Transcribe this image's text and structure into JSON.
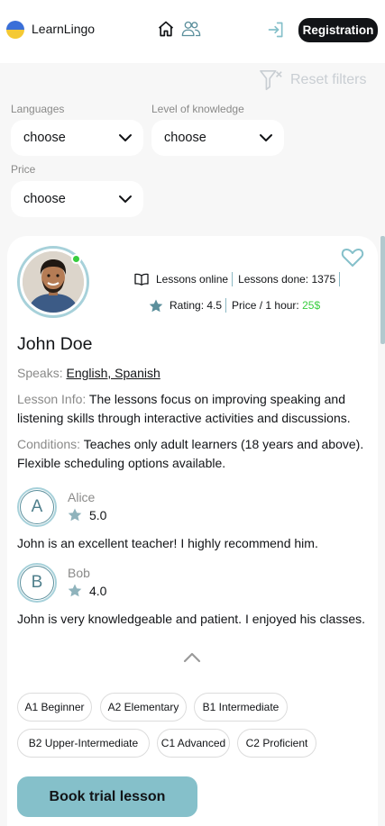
{
  "header": {
    "brand": "LearnLingo",
    "registration_label": "Registration"
  },
  "filters": {
    "reset_label": "Reset filters",
    "languages": {
      "label": "Languages",
      "value": "choose"
    },
    "level": {
      "label": "Level of knowledge",
      "value": "choose"
    },
    "price": {
      "label": "Price",
      "value": "choose"
    }
  },
  "teacher": {
    "lessons_online": "Lessons online",
    "lessons_done": "Lessons done: 1375",
    "rating": "Rating: 4.5",
    "price_prefix": "Price / 1 hour: ",
    "price_value": "25$",
    "name": "John Doe",
    "speaks_label": "Speaks:",
    "speaks_value": "English, Spanish",
    "lesson_info_label": "Lesson Info:",
    "lesson_info_value": "The lessons focus on improving speaking and listening skills through interactive activities and discussions.",
    "conditions_label": "Conditions:",
    "conditions_value": "Teaches only adult learners (18 years and above). Flexible scheduling options available.",
    "online_status_color": "#38cd3e"
  },
  "reviews": [
    {
      "initial": "A",
      "name": "Alice",
      "rating": "5.0",
      "text": "John is an excellent teacher! I highly recommend him."
    },
    {
      "initial": "B",
      "name": "Bob",
      "rating": "4.0",
      "text": "John is very knowledgeable and patient. I enjoyed his classes."
    }
  ],
  "levels": [
    "A1 Beginner",
    "A2 Elementary",
    "B1 Intermediate",
    "B2 Upper-Intermediate",
    "C1 Advanced",
    "C2 Proficient"
  ],
  "book_label": "Book trial lesson",
  "icons": {
    "home": "home-icon",
    "teachers": "users-icon",
    "login": "login-icon",
    "reset": "filter-clear-icon",
    "favorite": "heart-icon",
    "book": "book-open-icon",
    "rating": "star-icon",
    "collapse": "chevron-up-icon"
  },
  "colors": {
    "accent": "#85c0ca",
    "dark": "#121417",
    "muted": "#8a8a89",
    "price": "#38cd3e",
    "star": "#5b8f9c"
  }
}
